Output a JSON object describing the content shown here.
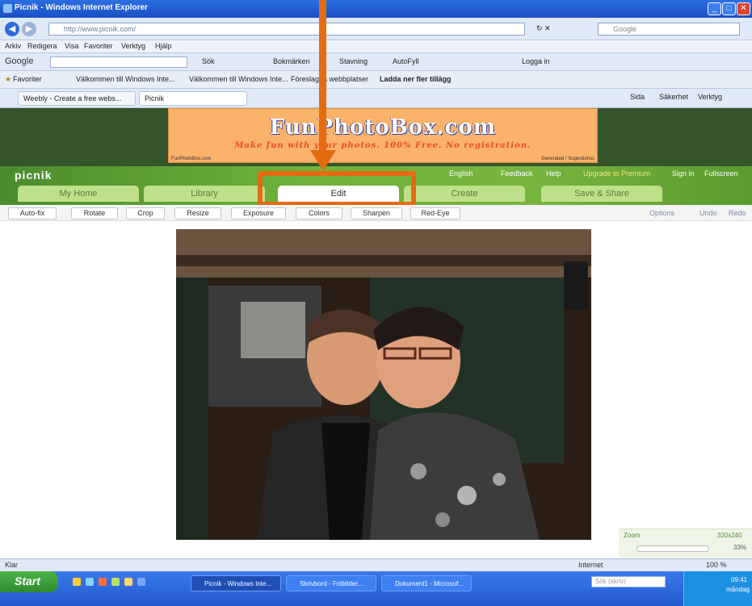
{
  "window": {
    "title": "Picnik - Windows Internet Explorer"
  },
  "ie": {
    "address_placeholder": "http://www.picnik.com/",
    "search_placeholder": "Google",
    "menu": [
      "Arkiv",
      "Redigera",
      "Visa",
      "Favoriter",
      "Verktyg",
      "Hjälp"
    ],
    "google_label": "Google",
    "google_items": [
      "Sök",
      "Bokmärken",
      "Stavning",
      "AutoFyll",
      "Logga in"
    ],
    "favorites_label": "Favoriter",
    "favorites_items": [
      "Välkommen till Windows Inte...",
      "Välkommen till Windows Inte...",
      "Föreslagna webbplatser",
      "Ladda ner fler tillägg"
    ],
    "tab_items": [
      "Weebly - Create a free webs...",
      "Picnik"
    ],
    "right_tools": [
      "Sida",
      "Säkerhet",
      "Verktyg"
    ]
  },
  "banner": {
    "title": "FunPhotoBox.com",
    "tagline": "Make fun with your photos. 100% Free. No registration.",
    "footer_left": "FunPhotoBox.com",
    "footer_right": "Generated / Sugestionss"
  },
  "picnik": {
    "logo": "picnik",
    "top_links": [
      "English",
      "Feedback",
      "Help",
      "Upgrade to Premium",
      "Sign in",
      "Fullscreen"
    ],
    "tabs": [
      {
        "label": "My Home",
        "active": false
      },
      {
        "label": "Library",
        "active": false
      },
      {
        "label": "Edit",
        "active": true
      },
      {
        "label": "Create",
        "active": false
      },
      {
        "label": "Save & Share",
        "active": false
      }
    ],
    "tools": [
      "Auto-fix",
      "Rotate",
      "Crop",
      "Resize",
      "Exposure",
      "Colors",
      "Sharpen",
      "Red-Eye"
    ],
    "options_label": "Options",
    "undo_label": "Undo",
    "redo_label": "Redo",
    "zoom_label": "Zoom",
    "zoom_size": "320x240",
    "zoom_value": "33%"
  },
  "status": {
    "left": "Klar",
    "zone": "Internet",
    "zoom": "100 %"
  },
  "taskbar": {
    "start": "Start",
    "tasks": [
      "Picnik - Windows Inte...",
      "Skrivbord - Fotbilder...",
      "Dokument1 - Microsof..."
    ],
    "search_placeholder": "Sök (skriv)",
    "clock": [
      "09:41",
      "måndag"
    ]
  },
  "colors": {
    "highlight": "#e46b12",
    "picnik_green": "#6fb23a"
  }
}
